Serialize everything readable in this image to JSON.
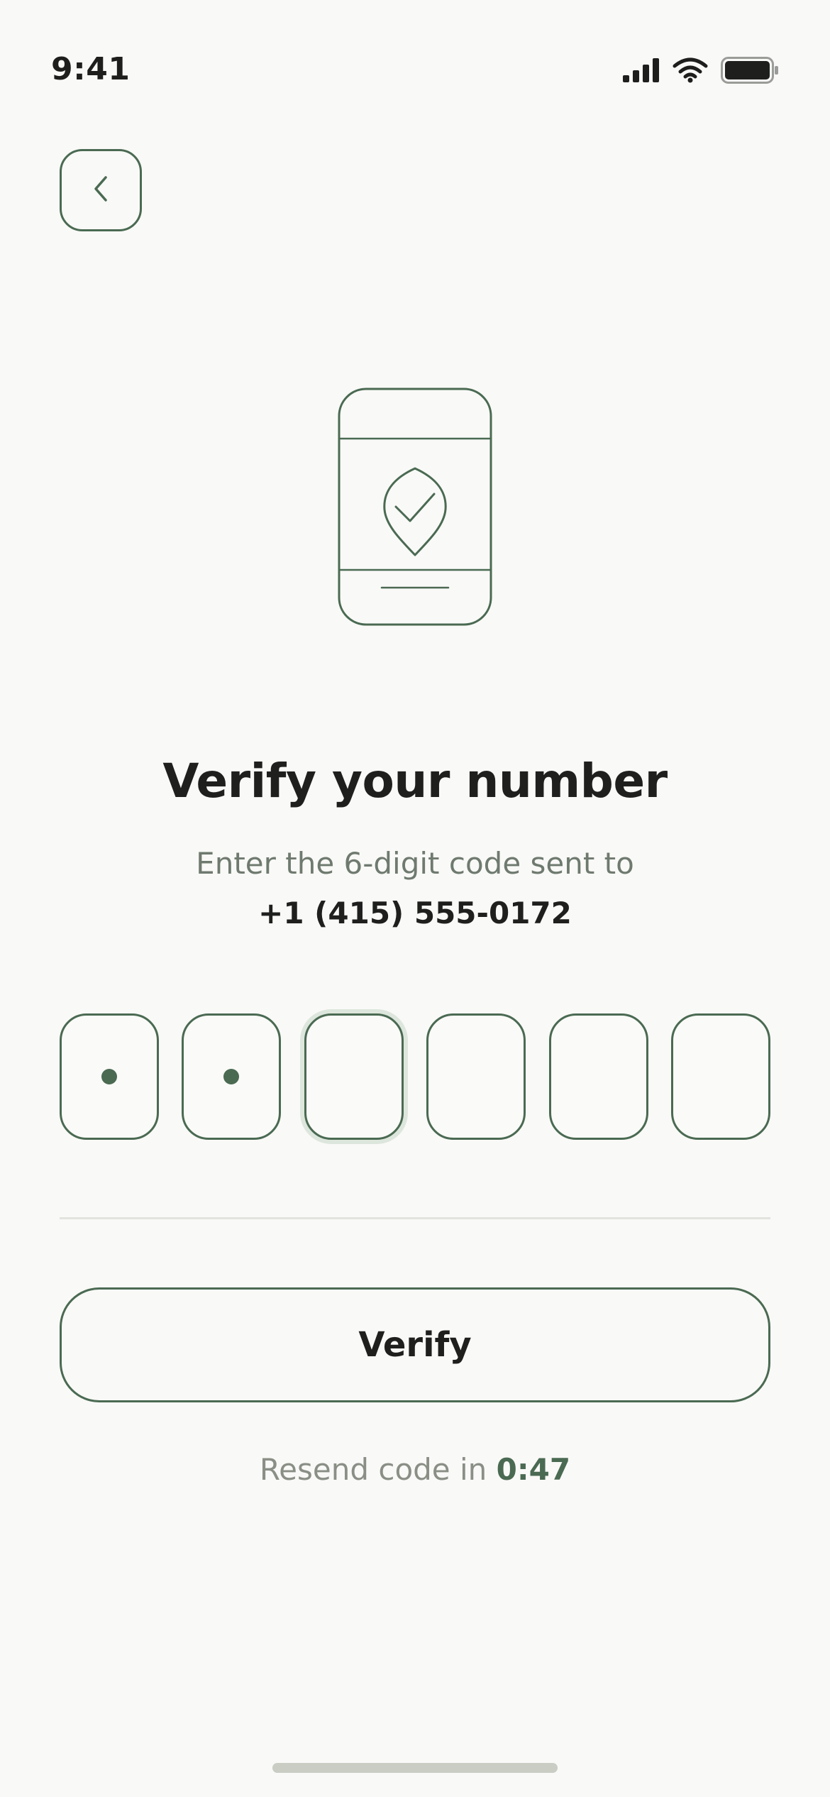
{
  "status_bar": {
    "time": "9:41",
    "icons": [
      "cellular-signal-icon",
      "wifi-icon",
      "battery-icon"
    ]
  },
  "nav": {
    "back_icon": "chevron-left-icon"
  },
  "illustration": {
    "icon": "phone-shield-check-icon"
  },
  "content": {
    "title": "Verify your number",
    "subtitle": "Enter the 6-digit code sent to",
    "phone_number": "+1 (415) 555-0172"
  },
  "otp": {
    "length": 6,
    "filled_count": 2,
    "active_index": 2
  },
  "actions": {
    "verify_label": "Verify",
    "resend_prefix": "Resend code in ",
    "resend_timer": "0:47"
  },
  "colors": {
    "background": "#f9f9f7",
    "accent": "#4a6a52",
    "text_primary": "#1f201d",
    "text_secondary": "#6f7a6f",
    "text_muted": "#8a8f86",
    "divider": "#e2e3df"
  }
}
